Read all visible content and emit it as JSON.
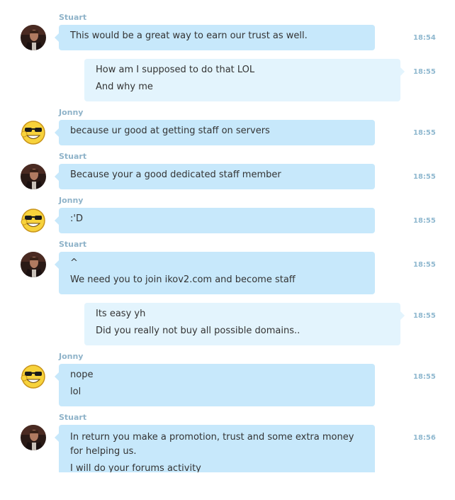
{
  "messages": [
    {
      "sender": "Stuart",
      "lines": [
        "This would be a great way to earn our trust as well."
      ],
      "time": "18:54"
    },
    {
      "lines": [
        "How am I supposed to do that LOL",
        "And why me"
      ],
      "time": "18:55"
    },
    {
      "sender": "Jonny",
      "lines": [
        "because ur good at getting staff on servers"
      ],
      "time": "18:55"
    },
    {
      "sender": "Stuart",
      "lines": [
        "Because your a good dedicated staff member"
      ],
      "time": "18:55"
    },
    {
      "sender": "Jonny",
      "lines": [
        ":'D"
      ],
      "time": "18:55"
    },
    {
      "sender": "Stuart",
      "lines": [
        "^",
        "We need you to join ikov2.com and become staff"
      ],
      "time": "18:55"
    },
    {
      "lines": [
        "Its easy yh",
        "Did you really not buy all possible domains.."
      ],
      "time": "18:55"
    },
    {
      "sender": "Jonny",
      "lines": [
        "nope",
        "lol"
      ],
      "time": "18:55"
    },
    {
      "sender": "Stuart",
      "lines": [
        "In return you make a promotion, trust and some extra money for helping us.",
        "I will do your forums activity"
      ],
      "time": "18:56"
    }
  ],
  "avatars": {
    "stuart": "portrait-photo",
    "jonny": "sunglasses-smiley-icon"
  },
  "colors": {
    "incoming_bubble": "#c7e8fb",
    "outgoing_bubble": "#e3f4fd",
    "sender_name": "#8fb3c9",
    "timestamp": "#8fb8cf"
  }
}
